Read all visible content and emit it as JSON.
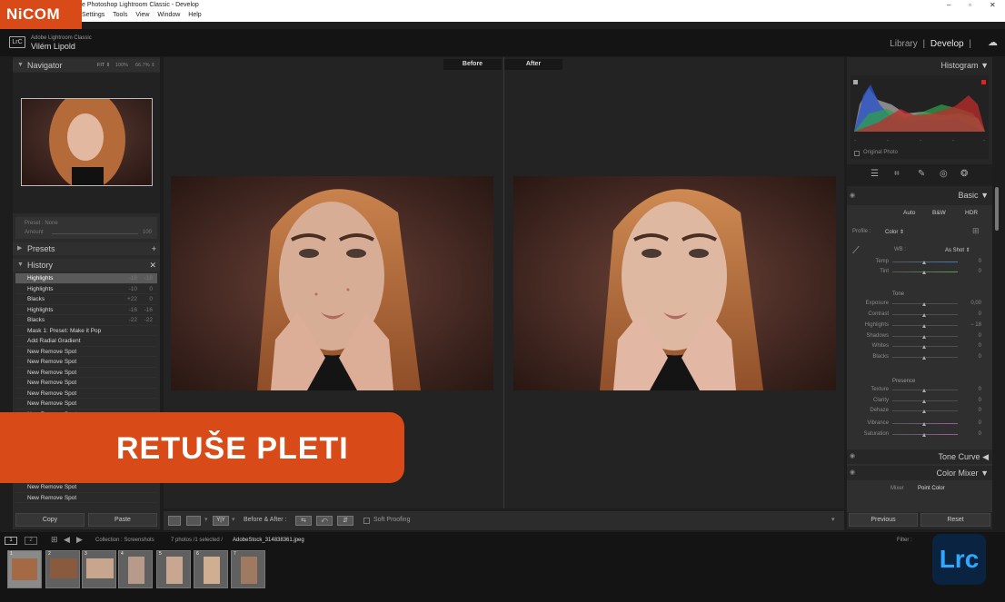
{
  "window": {
    "title": "e Photoshop Lightroom Classic - Develop",
    "menu": [
      "Settings",
      "Tools",
      "View",
      "Window",
      "Help"
    ],
    "controls": {
      "minimize": "–",
      "maximize": "▫",
      "close": "✕"
    }
  },
  "brand": {
    "nicom": "NiCOM",
    "accent": "#d84a17"
  },
  "identity": {
    "badge": "LrC",
    "app_name": "Adobe Lightroom Classic",
    "user": "Vilém Lipold",
    "modules": [
      "Library",
      "Develop"
    ],
    "active_module": "Develop",
    "separator": "|"
  },
  "navigator": {
    "title": "Navigator",
    "zoom_options": [
      "FIT ⇕",
      "100%",
      "66.7% ⇕"
    ],
    "preset_label": "Preset : None",
    "amount_label": "Amount",
    "amount_value": "100"
  },
  "presets": {
    "title": "Presets",
    "add": "+"
  },
  "history": {
    "title": "History",
    "close": "✕",
    "items": [
      {
        "label": "Highlights",
        "v1": "-18",
        "v2": "-18",
        "selected": true
      },
      {
        "label": "Highlights",
        "v1": "-10",
        "v2": "0"
      },
      {
        "label": "Blacks",
        "v1": "+22",
        "v2": "0"
      },
      {
        "label": "Highlights",
        "v1": "-16",
        "v2": "-16"
      },
      {
        "label": "Blacks",
        "v1": "-22",
        "v2": "-22"
      },
      {
        "label": "Mask 1: Preset: Make it Pop",
        "v1": "",
        "v2": ""
      },
      {
        "label": "Add Radial Gradient",
        "v1": "",
        "v2": ""
      },
      {
        "label": "New Remove Spot",
        "v1": "",
        "v2": ""
      },
      {
        "label": "New Remove Spot",
        "v1": "",
        "v2": ""
      },
      {
        "label": "New Remove Spot",
        "v1": "",
        "v2": ""
      },
      {
        "label": "New Remove Spot",
        "v1": "",
        "v2": ""
      },
      {
        "label": "New Remove Spot",
        "v1": "",
        "v2": ""
      },
      {
        "label": "New Remove Spot",
        "v1": "",
        "v2": ""
      },
      {
        "label": "New Remove Spot",
        "v1": "",
        "v2": ""
      },
      {
        "label": "New Remove Spot",
        "v1": "",
        "v2": ""
      },
      {
        "label": "New Remove Spot",
        "v1": "",
        "v2": ""
      },
      {
        "label": "New Remove Spot",
        "v1": "",
        "v2": ""
      },
      {
        "label": "New Remove Spot",
        "v1": "",
        "v2": ""
      },
      {
        "label": "New Remove Spot",
        "v1": "",
        "v2": ""
      },
      {
        "label": "New Remove Spot",
        "v1": "",
        "v2": ""
      },
      {
        "label": "New Remove Spot",
        "v1": "",
        "v2": ""
      },
      {
        "label": "New Remove Spot",
        "v1": "",
        "v2": ""
      }
    ]
  },
  "left_buttons": {
    "copy": "Copy",
    "paste": "Paste"
  },
  "compare": {
    "before": "Before",
    "after": "After"
  },
  "toolbar": {
    "before_after": "Before & After :",
    "soft_proofing": "Soft Proofing",
    "swap_icon": "⇆",
    "copy_icon": "⤺",
    "arrows_icon": "⇵",
    "yy_label": "Y|Y"
  },
  "histogram": {
    "title": "Histogram",
    "original_photo": "Original Photo",
    "dashes": [
      "-",
      "-",
      "-",
      "-",
      "-"
    ]
  },
  "basic": {
    "title": "Basic",
    "treatment": [
      "Auto",
      "B&W",
      "HDR"
    ],
    "profile_label": "Profile :",
    "profile_value": "Color ⇕",
    "wb_label": "WB :",
    "wb_value": "As Shot ⇕",
    "wb_sliders": [
      {
        "label": "Temp",
        "value": "0"
      },
      {
        "label": "Tint",
        "value": "0"
      }
    ],
    "tone_title": "Tone",
    "tone_sliders": [
      {
        "label": "Exposure",
        "value": "0,00"
      },
      {
        "label": "Contrast",
        "value": "0"
      },
      {
        "label": "Highlights",
        "value": "− 18"
      },
      {
        "label": "Shadows",
        "value": "0"
      },
      {
        "label": "Whites",
        "value": "0"
      },
      {
        "label": "Blacks",
        "value": "0"
      }
    ],
    "presence_title": "Presence",
    "presence_sliders": [
      {
        "label": "Texture",
        "value": "0"
      },
      {
        "label": "Clarity",
        "value": "0"
      },
      {
        "label": "Dehaze",
        "value": "0"
      },
      {
        "label": "Vibrance",
        "value": "0"
      },
      {
        "label": "Saturation",
        "value": "0"
      }
    ]
  },
  "tone_curve": {
    "title": "Tone Curve"
  },
  "color_mixer": {
    "title": "Color Mixer",
    "tabs": [
      "Mixer",
      "Point Color"
    ]
  },
  "right_buttons": {
    "previous": "Previous",
    "reset": "Reset"
  },
  "filmstrip": {
    "views": [
      "1",
      "2"
    ],
    "path": "Collection : Screenshots",
    "count": "7 photos /1 selected /",
    "filename": "AdobeStock_314838361.jpeg",
    "filter_label": "Filter :",
    "thumb_numbers": [
      "1",
      "2",
      "3",
      "4",
      "5",
      "6",
      "7"
    ]
  },
  "overlay": {
    "banner": "RETUŠE PLETI",
    "logo": "Lrc"
  }
}
